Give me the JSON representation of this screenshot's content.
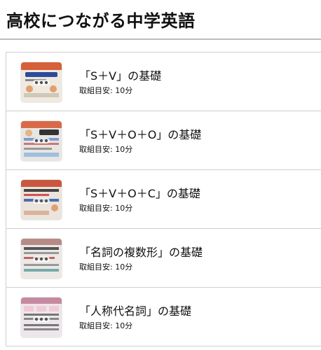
{
  "page": {
    "title": "高校につながる中学英語"
  },
  "lessons": [
    {
      "title": "「S＋V」の基礎",
      "meta": "取組目安: 10分",
      "thumb_header": "#d6603a",
      "thumb_bg": "#efe9df"
    },
    {
      "title": "「S＋V＋O＋O」の基礎",
      "meta": "取組目安: 10分",
      "thumb_header": "#d86a4a",
      "thumb_bg": "#e8e6e2"
    },
    {
      "title": "「S＋V＋O＋C」の基礎",
      "meta": "取組目安: 10分",
      "thumb_header": "#c9573f",
      "thumb_bg": "#ebe4dc"
    },
    {
      "title": "「名詞の複数形」の基礎",
      "meta": "取組目安: 10分",
      "thumb_header": "#b88a86",
      "thumb_bg": "#ece8e6"
    },
    {
      "title": "「人称代名詞」の基礎",
      "meta": "取組目安: 10分",
      "thumb_header": "#c58aa0",
      "thumb_bg": "#ede6ea"
    }
  ]
}
